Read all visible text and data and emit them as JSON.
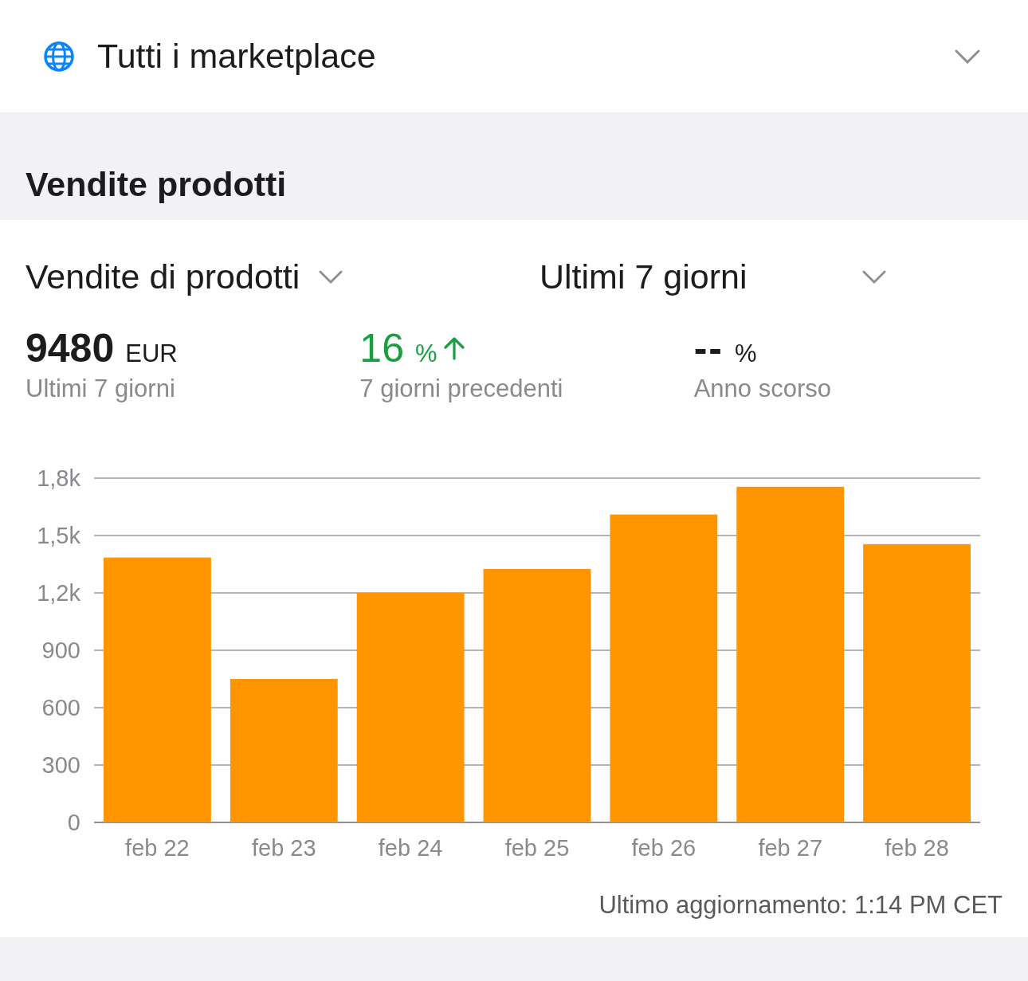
{
  "marketplace_selector": {
    "label": "Tutti i marketplace"
  },
  "section_title": "Vendite prodotti",
  "metric_selector": {
    "label": "Vendite di prodotti"
  },
  "period_selector": {
    "label": "Ultimi 7 giorni"
  },
  "stats": [
    {
      "kind": "total",
      "value": "9480",
      "unit": "EUR",
      "caption": "Ultimi 7 giorni"
    },
    {
      "kind": "change",
      "value": "16",
      "unit": "%",
      "rising": true,
      "caption": "7 giorni precedenti"
    },
    {
      "kind": "empty",
      "value": "--",
      "unit": "%",
      "caption": "Anno scorso"
    }
  ],
  "chart_data": {
    "type": "bar",
    "categories": [
      "feb 22",
      "feb 23",
      "feb 24",
      "feb 25",
      "feb 26",
      "feb 27",
      "feb 28"
    ],
    "series": [
      {
        "color": "#ff9500",
        "values": [
          1385,
          750,
          1200,
          1325,
          1610,
          1755,
          1455
        ]
      }
    ],
    "ylim": [
      0,
      1800
    ],
    "grid": true,
    "yticks": [
      {
        "value": 0,
        "label": "0"
      },
      {
        "value": 300,
        "label": "300"
      },
      {
        "value": 600,
        "label": "600"
      },
      {
        "value": 900,
        "label": "900"
      },
      {
        "value": 1200,
        "label": "1,2k"
      },
      {
        "value": 1500,
        "label": "1,5k"
      },
      {
        "value": 1800,
        "label": "1,8k"
      }
    ]
  },
  "last_updated": "Ultimo aggiornamento: 1:14 PM CET"
}
